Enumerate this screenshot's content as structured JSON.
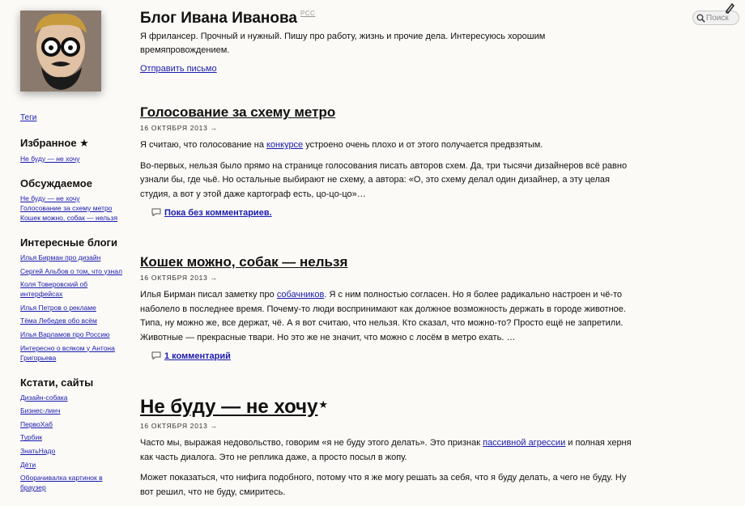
{
  "header": {
    "title": "Блог Ивана Иванова",
    "rss_label": "РСС",
    "description": "Я фрилансер. Прочный и нужный. Пишу про работу, жизнь и прочие дела. Интересуюсь хорошим времяпровождением.",
    "send_letter": "Отправить письмо",
    "search_placeholder": "Поиск"
  },
  "sidebar": {
    "tags_link": "Теги",
    "favorites": {
      "heading": "Избранное ★",
      "items": [
        "Не буду — не хочу"
      ]
    },
    "discussed": {
      "heading": "Обсуждаемое",
      "items": [
        "Не буду — не хочу",
        "Голосование за схему метро",
        "Кошек можно, собак — нельзя"
      ]
    },
    "blogs": {
      "heading": "Интересные блоги",
      "items": [
        "Илья Бирман про дизайн",
        "Сергей Альбов о том, что узнал",
        "Коля Товеровский об интерфейсах",
        "Илья Петров о рекламе",
        "Тёма Лебедев обо всём",
        "Илья Варламов про Россию",
        "Интересно о всяком у Антона Григорьева"
      ]
    },
    "sites": {
      "heading": "Кстати, сайты",
      "items": [
        "Дизайн-собака",
        "Бизнес-линч",
        "ПервоХаб",
        "Турбик",
        "ЗнатьНадо",
        "Дёти",
        "Оборачивалка картинок в браузер"
      ]
    }
  },
  "posts": [
    {
      "title": "Голосование за схему метро",
      "date": "16 ОКТЯБРЯ 2013 →",
      "p1_before": "Я считаю, что голосование на ",
      "p1_link": "конкурсе",
      "p1_after": " устроено очень плохо и от этого получается предвзятым.",
      "p2": "Во-первых, нельзя было прямо на странице голосования писать авторов схем. Да, три тысячи дизайнеров всё равно узнали бы, где чьё. Но остальные выбирают не схему, а автора: «О, это схему делал один дизайнер, а эту целая студия, а вот у этой даже картограф есть, цо-цо-цо»…",
      "comments": "Пока без комментариев."
    },
    {
      "title": "Кошек можно, собак — нельзя",
      "date": "16 ОКТЯБРЯ 2013 →",
      "p1_before": "Илья Бирман писал заметку про ",
      "p1_link": "собачников",
      "p1_after": ". Я с ним полностью согласен. Но я более радикально настроен и чё-то наболело в последнее время. Почему-то люди воспринимают как должное возможность держать в городе животное. Типа, ну можно же, все держат, чё. А я вот считаю, что нельзя. Кто сказал, что можно-то? Просто ещё не запретили. Животные — прекрасные твари. Но это же не значит, что можно с лосём в метро ехать. …",
      "comments": "1 комментарий"
    },
    {
      "title": "Не буду — не хочу",
      "star": "★",
      "date": "16 ОКТЯБРЯ 2013 →",
      "p1_before": "Часто мы, выражая недовольство, говорим «я не буду этого делать». Это признак ",
      "p1_link": "пассивной агрессии",
      "p1_after": " и полная херня как часть диалога. Это не реплика даже, а просто посыл в жопу.",
      "p2": "Может показаться, что нифига подобного, потому что я же могу решать за себя, что я буду делать, а чего не буду. Ну вот решил, что не буду, смиритесь."
    }
  ],
  "colors": {
    "background": "#fbfaf7",
    "link": "#1a1ab0",
    "text": "#111111"
  },
  "icons": [
    "search-icon",
    "pencil-icon",
    "comment-bubble-icon"
  ]
}
